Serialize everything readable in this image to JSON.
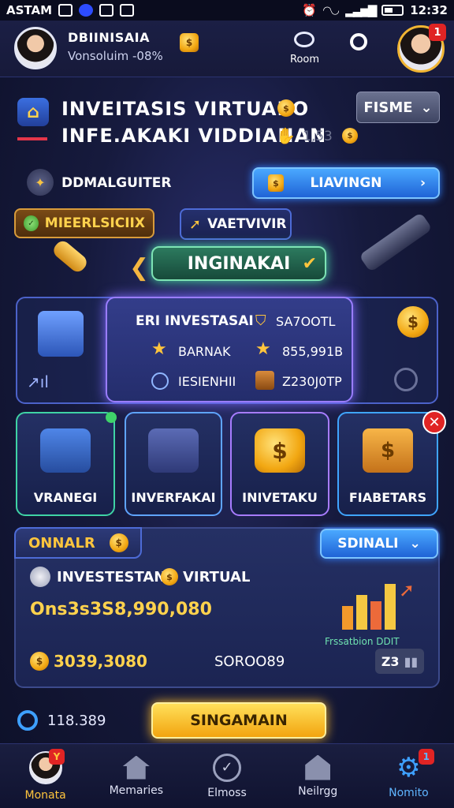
{
  "status_bar": {
    "carrier": "ASTAM",
    "time": "12:32"
  },
  "header": {
    "name": "DBIINISAIA",
    "subtitle": "Vonsoluim -08%",
    "action_label": "Room"
  },
  "banner": {
    "line1": "INVEITASIS VIRTUABO",
    "line2": "INFE.AKAKI VIDDIANAN",
    "value": "1,53",
    "dropdown_label": "FISME"
  },
  "row2": {
    "label": "DDMALGUITER",
    "button_label": "LIAVINGN"
  },
  "tags": {
    "gold": "MIEERLSICIIX",
    "blue": "VAETVIVIR"
  },
  "center_pill": "INGINAKAI",
  "info_panel": {
    "title": "ERI INVESTASAI",
    "title_value": "SA7OOTL",
    "rows": [
      {
        "label": "BARNAK",
        "value": "855,991B"
      },
      {
        "label": "IESIENHII",
        "value": "Z230J0TP"
      }
    ]
  },
  "cards": [
    {
      "label": "VRANEGI",
      "color": "#3fd3a5"
    },
    {
      "label": "INVERFAKAI",
      "color": "#5fa4ff"
    },
    {
      "label": "INIVETAKU",
      "color": "#a77cff"
    },
    {
      "label": "FIABETARS",
      "color": "#3fa5ff"
    }
  ],
  "summary": {
    "tab_label": "ONNALR",
    "dropdown_label": "SDINALI",
    "row_label_a": "INVESTESTAN",
    "row_label_b": "VIRTUAL",
    "big_value": "Ons3s3S8,990,080",
    "coin_value": "3039,3080",
    "mid_value": "SOROO89",
    "graph_caption": "Frssatbion DDIT",
    "chip_text": "Z3"
  },
  "bottom_row": {
    "counter": "118.389",
    "cta_label": "SINGAMAIN"
  },
  "nav": [
    {
      "label": "Monata",
      "badge": "Y"
    },
    {
      "label": "Memaries"
    },
    {
      "label": "Elmoss"
    },
    {
      "label": "Neilrgg"
    },
    {
      "label": "Nomito",
      "badge": "1"
    }
  ],
  "colors": {
    "accent_gold": "#ffc53d",
    "accent_blue": "#2f7fff",
    "accent_green": "#49d6a0",
    "alert_red": "#e02424"
  }
}
